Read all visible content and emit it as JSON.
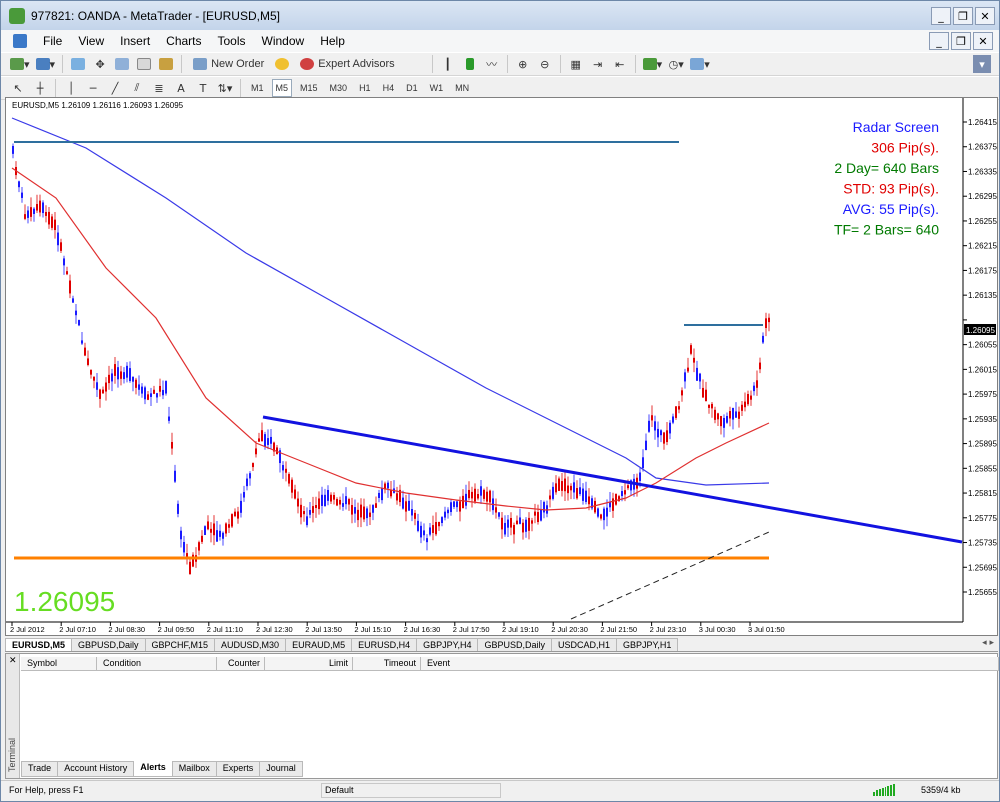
{
  "window": {
    "title": "977821: OANDA - MetaTrader - [EURUSD,M5]"
  },
  "menu": {
    "items": [
      "File",
      "View",
      "Insert",
      "Charts",
      "Tools",
      "Window",
      "Help"
    ]
  },
  "toolbar": {
    "new_order": "New Order",
    "expert_advisors": "Expert Advisors"
  },
  "timeframes": [
    "M1",
    "M5",
    "M15",
    "M30",
    "H1",
    "H4",
    "D1",
    "W1",
    "MN"
  ],
  "active_timeframe": "M5",
  "chart": {
    "info": "EURUSD,M5  1.26109 1.26116 1.26093 1.26095",
    "big_price": "1.26095",
    "current_price": "1.26095",
    "radar": [
      {
        "text": "Radar Screen",
        "color": "#1a1aff"
      },
      {
        "text": "306 Pip(s).",
        "color": "#e00000"
      },
      {
        "text": "2 Day= 640 Bars",
        "color": "#007a00"
      },
      {
        "text": "STD: 93 Pip(s).",
        "color": "#e00000"
      },
      {
        "text": "AVG: 55 Pip(s).",
        "color": "#1a1aff"
      },
      {
        "text": "TF= 2 Bars= 640",
        "color": "#007a00"
      }
    ],
    "y_ticks": [
      "1.26415",
      "1.26375",
      "1.26335",
      "1.26295",
      "1.26255",
      "1.26215",
      "1.26175",
      "1.26135",
      "1.26095",
      "1.26055",
      "1.26015",
      "1.25975",
      "1.25935",
      "1.25895",
      "1.25855",
      "1.25815",
      "1.25775",
      "1.25735",
      "1.25695",
      "1.25655"
    ],
    "x_ticks": [
      "2 Jul 2012",
      "2 Jul 07:10",
      "2 Jul 08:30",
      "2 Jul 09:50",
      "2 Jul 11:10",
      "2 Jul 12:30",
      "2 Jul 13:50",
      "2 Jul 15:10",
      "2 Jul 16:30",
      "2 Jul 17:50",
      "2 Jul 19:10",
      "2 Jul 20:30",
      "2 Jul 21:50",
      "2 Jul 23:10",
      "3 Jul 00:30",
      "3 Jul 01:50"
    ],
    "colors": {
      "bull": "#1a1aff",
      "bear": "#e00000",
      "ma_fast": "#e03030",
      "ma_slow": "#3a3ae8",
      "trend": "#1212e0",
      "support": "#ff8000",
      "resist": "#2e6f9e",
      "big_price": "#66dd22"
    }
  },
  "chart_tabs": [
    "EURUSD,M5",
    "GBPUSD,Daily",
    "GBPCHF,M15",
    "AUDUSD,M30",
    "EURAUD,M5",
    "EURUSD,H4",
    "GBPJPY,H4",
    "GBPUSD,Daily",
    "USDCAD,H1",
    "GBPJPY,H1"
  ],
  "terminal": {
    "columns": [
      "Symbol",
      "Condition",
      "Counter",
      "Limit",
      "Timeout",
      "Event"
    ],
    "tabs": [
      "Trade",
      "Account History",
      "Alerts",
      "Mailbox",
      "Experts",
      "Journal"
    ],
    "active_tab": "Alerts",
    "side_label": "Terminal"
  },
  "status": {
    "help": "For Help, press F1",
    "profile": "Default",
    "traffic": "5359/4 kb"
  }
}
